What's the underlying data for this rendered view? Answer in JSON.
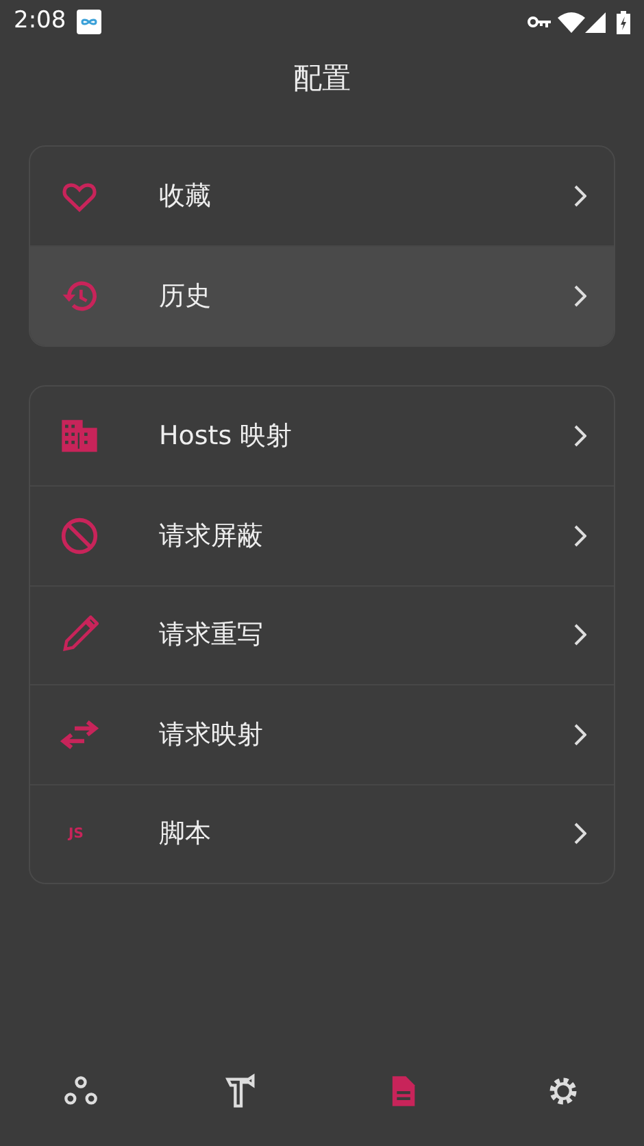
{
  "status_bar": {
    "time": "2:08"
  },
  "title": "配置",
  "groups": [
    {
      "items": [
        {
          "label": "收藏",
          "highlighted": false
        },
        {
          "label": "历史",
          "highlighted": true
        }
      ]
    },
    {
      "items": [
        {
          "label": "Hosts 映射",
          "highlighted": false
        },
        {
          "label": "请求屏蔽",
          "highlighted": false
        },
        {
          "label": "请求重写",
          "highlighted": false
        },
        {
          "label": "请求映射",
          "highlighted": false
        },
        {
          "icon_text": "JS",
          "label": "脚本",
          "highlighted": false
        }
      ]
    }
  ],
  "bottom_nav": [
    {
      "selected": false
    },
    {
      "selected": false
    },
    {
      "selected": true
    },
    {
      "selected": false
    }
  ]
}
